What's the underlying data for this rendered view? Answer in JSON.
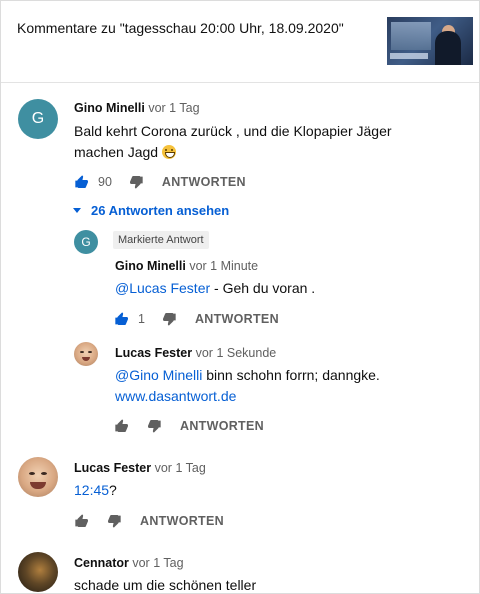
{
  "header": {
    "title": "Kommentare zu \"tagesschau 20:00 Uhr, 18.09.2020\""
  },
  "comments": [
    {
      "avatar_letter": "G",
      "author": "Gino Minelli",
      "time": "vor 1 Tag",
      "text": "Bald kehrt Corona zurück , und die Klopapier Jäger machen Jagd",
      "likes": "90",
      "reply_label": "ANTWORTEN",
      "replies_toggle": "26 Antworten ansehen"
    },
    {
      "author": "Lucas Fester",
      "time": "vor 1 Tag",
      "link": "12:45",
      "text_after": "?",
      "reply_label": "ANTWORTEN"
    },
    {
      "author": "Cennator",
      "time": "vor 1 Tag",
      "text": "schade um die schönen teller"
    }
  ],
  "replies": [
    {
      "avatar_letter": "G",
      "badge": "Markierte Antwort",
      "author": "Gino Minelli",
      "time": "vor 1 Minute",
      "mention": "@Lucas Fester",
      "text": " - Geh du voran .",
      "likes": "1",
      "reply_label": "ANTWORTEN"
    },
    {
      "author": "Lucas Fester",
      "time": "vor 1 Sekunde",
      "mention": "@Gino Minelli",
      "text": " binn schohn forrn; danngke.",
      "link": "www.dasantwort.de",
      "reply_label": "ANTWORTEN"
    }
  ],
  "icons": {
    "like": "thumb-up-icon",
    "dislike": "thumb-down-icon",
    "expand": "caret-down-icon"
  },
  "colors": {
    "link": "#065fd4",
    "avatar_teal": "#3f8fa1",
    "liked": "#065fd4"
  }
}
